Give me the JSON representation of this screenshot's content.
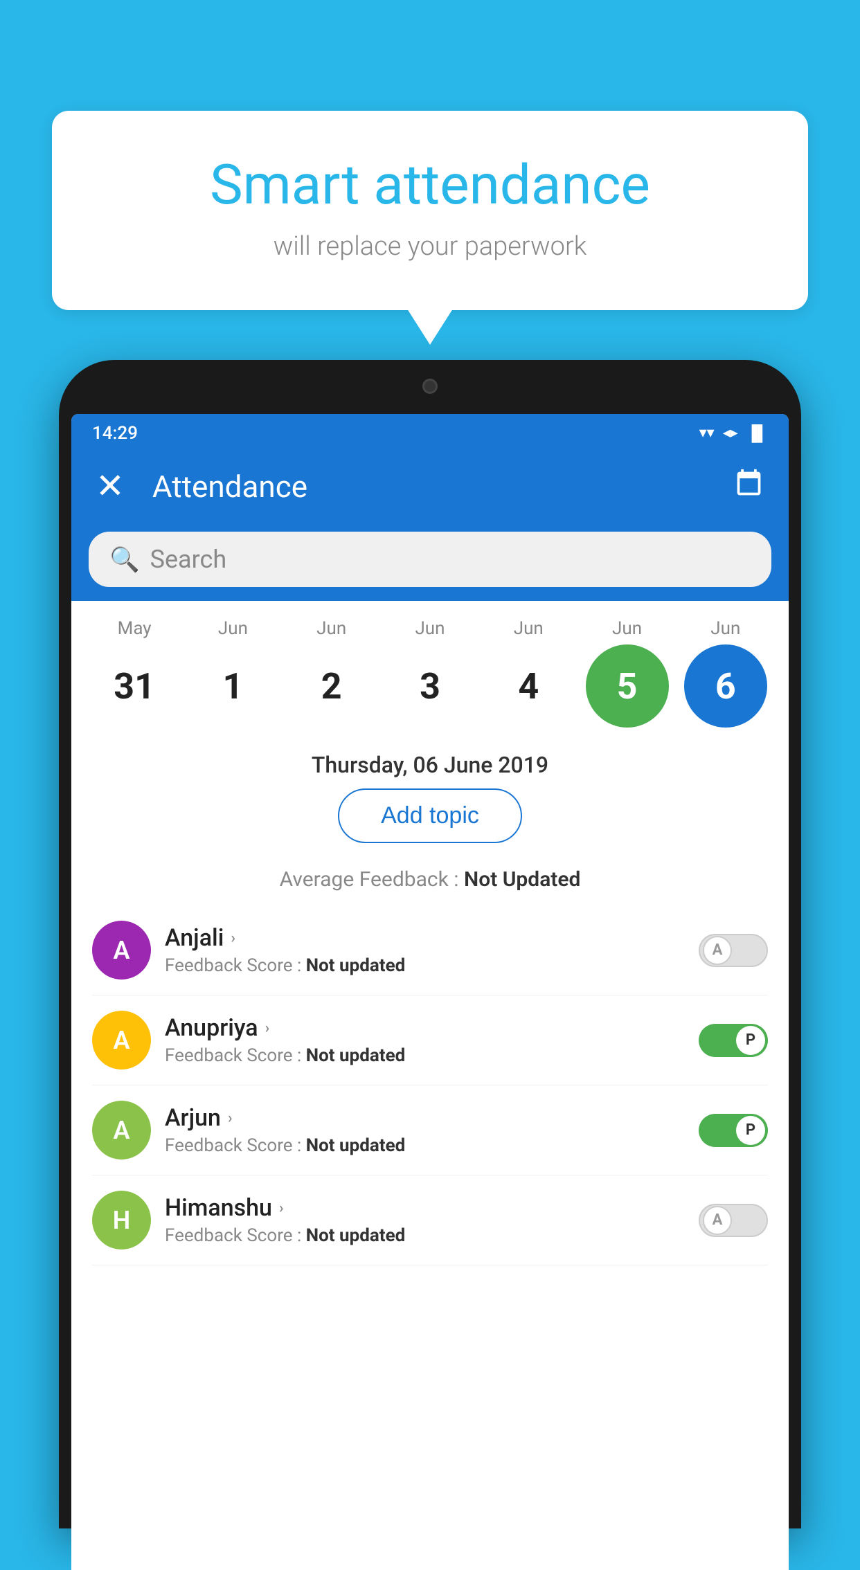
{
  "background_color": "#29B6E8",
  "speech_bubble": {
    "title": "Smart attendance",
    "subtitle": "will replace your paperwork"
  },
  "status_bar": {
    "time": "14:29",
    "wifi": "▼",
    "signal": "▲",
    "battery": "▐"
  },
  "app_bar": {
    "title": "Attendance",
    "close_label": "×",
    "calendar_icon": "📅"
  },
  "search": {
    "placeholder": "Search"
  },
  "calendar": {
    "months": [
      "May",
      "Jun",
      "Jun",
      "Jun",
      "Jun",
      "Jun",
      "Jun"
    ],
    "dates": [
      "31",
      "1",
      "2",
      "3",
      "4",
      "5",
      "6"
    ],
    "today_index": 5,
    "selected_index": 6
  },
  "selected_date_label": "Thursday, 06 June 2019",
  "add_topic_label": "Add topic",
  "average_feedback": {
    "label": "Average Feedback : ",
    "value": "Not Updated"
  },
  "students": [
    {
      "name": "Anjali",
      "avatar_letter": "A",
      "avatar_color": "#9C27B0",
      "feedback_label": "Feedback Score : ",
      "feedback_value": "Not updated",
      "toggle_state": "off",
      "toggle_letter": "A"
    },
    {
      "name": "Anupriya",
      "avatar_letter": "A",
      "avatar_color": "#FFC107",
      "feedback_label": "Feedback Score : ",
      "feedback_value": "Not updated",
      "toggle_state": "on",
      "toggle_letter": "P"
    },
    {
      "name": "Arjun",
      "avatar_letter": "A",
      "avatar_color": "#8BC34A",
      "feedback_label": "Feedback Score : ",
      "feedback_value": "Not updated",
      "toggle_state": "on",
      "toggle_letter": "P"
    },
    {
      "name": "Himanshu",
      "avatar_letter": "H",
      "avatar_color": "#8BC34A",
      "feedback_label": "Feedback Score : ",
      "feedback_value": "Not updated",
      "toggle_state": "off",
      "toggle_letter": "A"
    }
  ]
}
